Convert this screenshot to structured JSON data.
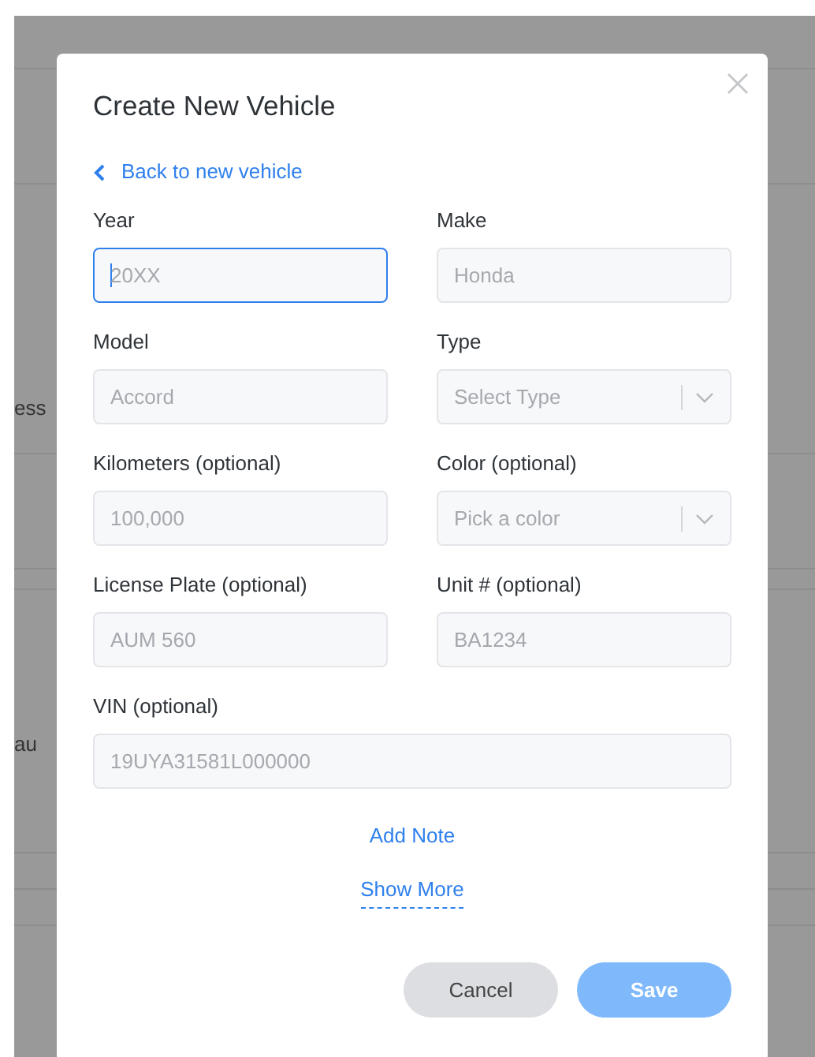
{
  "background": {
    "texts": [
      "ess",
      "au"
    ]
  },
  "dialog": {
    "title": "Create New Vehicle",
    "back_link": "Back to new vehicle",
    "fields": [
      {
        "kind": "text",
        "label": "Year",
        "placeholder": "20XX",
        "focused": true,
        "wide": false
      },
      {
        "kind": "text",
        "label": "Make",
        "placeholder": "Honda",
        "focused": false,
        "wide": false
      },
      {
        "kind": "text",
        "label": "Model",
        "placeholder": "Accord",
        "focused": false,
        "wide": false
      },
      {
        "kind": "select",
        "label": "Type",
        "placeholder": "Select Type",
        "focused": false,
        "wide": false
      },
      {
        "kind": "text",
        "label": "Kilometers  (optional)",
        "placeholder": "100,000",
        "focused": false,
        "wide": false
      },
      {
        "kind": "select",
        "label": "Color (optional)",
        "placeholder": "Pick a color",
        "focused": false,
        "wide": false
      },
      {
        "kind": "text",
        "label": "License Plate (optional)",
        "placeholder": "AUM 560",
        "focused": false,
        "wide": false
      },
      {
        "kind": "text",
        "label": "Unit # (optional)",
        "placeholder": "BA1234",
        "focused": false,
        "wide": false
      },
      {
        "kind": "text",
        "label": "VIN (optional)",
        "placeholder": "19UYA31581L000000",
        "focused": false,
        "wide": true
      }
    ],
    "add_note": "Add Note",
    "show_more": "Show More",
    "buttons": [
      {
        "label": "Cancel",
        "kind": "secondary",
        "disabled": false
      },
      {
        "label": "Save",
        "kind": "primary",
        "disabled": true
      }
    ]
  }
}
